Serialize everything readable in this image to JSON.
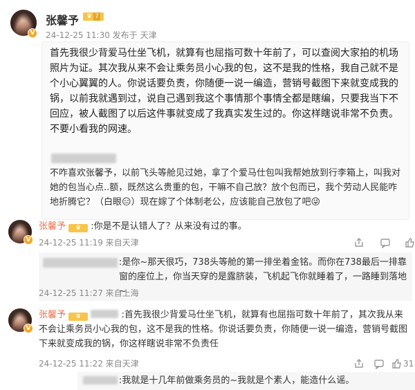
{
  "post": {
    "author": "张馨予",
    "badge": "V",
    "level": "7",
    "meta": "24-12-25 11:30 发布于 天津",
    "text": "首先我很少背爱马仕坐飞机，就算有也屈指可数十年前了，可以查阅大家拍的机场照片为证。其次我从来不会让乘务员小心我的包，这不是我的性格，我自己就不是个小心翼翼的人。你说话要负责，你随便一说一编造，营销号截图下来就变成我的锅，以前我就遇到过，说自己遇到我这个事情那个事情全都是瞎编，只要我当下不回应，被人截图了以后这件事就变成了我真实发生过的。你这样瞎说非常不负责。不要小看我的网速。",
    "quoted": "不咋喜欢张馨予，以前飞头等舱见过她，拿了个爱马仕包叫我帮她放到行李箱上，叫我对她的包当心点..额，既然这么贵重的包，干嘛不自己放？放个包而已，我个劳动人民能咋地折腾它？（白眼😑）现在嫁了个体制老公，应该能自己放包了吧😜"
  },
  "replies": [
    {
      "author": "张馨予",
      "text": ":你是不是认错人了？从来没有过的事。",
      "meta": "24-12-25 11:19 来自天津"
    },
    {
      "text": ":是你~那天很巧，738头等舱的第一排坐着金铭。而你在738最后一排靠窗的座位上，你当天穿的是露脐装，飞机起飞你就睡着了，一路睡到落地~",
      "meta": "24-12-25 11:27 来自上海"
    },
    {
      "author": "张馨予",
      "text": ":首先我很少背爱马仕坐飞机，就算有也屈指可数十年前了，其次我从来不会让乘务员小心我的包，这不是我的性格。你说话要负责，你随便一说一编造，营销号截图下来就变成我的锅，你这样瞎说非常不负责任",
      "meta": "24-12-25 11:22 来自天津",
      "like_count": "31"
    },
    {
      "text": ":我就是十几年前做乘务员的~我就是个素人，能造什么谣。"
    }
  ],
  "icons": [
    "share-icon",
    "comment-icon",
    "like-icon"
  ]
}
